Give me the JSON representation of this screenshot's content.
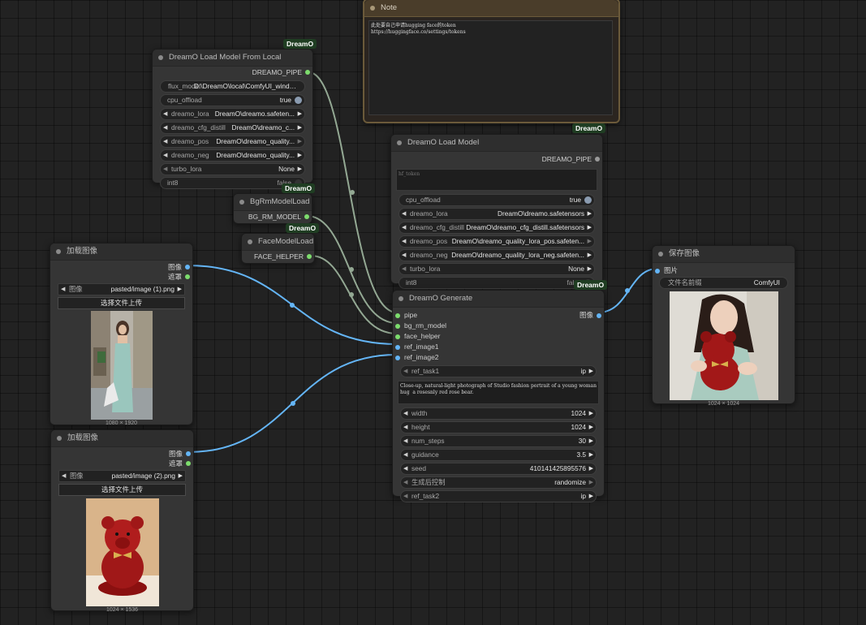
{
  "colors": {
    "canvas": "#222222",
    "node_bg": "#353535",
    "note_border": "#6b5a3a",
    "badge_bg": "#1f3d22",
    "image_wire": "#64b5f6",
    "model_wire": "#93a893",
    "socket_green": "#7ddc6d",
    "socket_blue": "#64b5f6"
  },
  "note": {
    "title": "Note",
    "text": "此处要自己申请hugging face的token\nhttps://huggingface.co/settings/tokens"
  },
  "badges": {
    "dreamo": "DreamO"
  },
  "local_model": {
    "title": "DreamO Load Model From Local",
    "output": "DREAMO_PIPE",
    "widgets": [
      {
        "label": "flux_model",
        "value": "D:\\DreamO\\local\\ComfyUI_windows"
      },
      {
        "label": "cpu_offload",
        "value": "true"
      },
      {
        "label": "dreamo_lora",
        "value": "DreamO\\dreamo.safeten..."
      },
      {
        "label": "dreamo_cfg_distill",
        "value": "DreamO\\dreamo_c..."
      },
      {
        "label": "dreamo_pos",
        "value": "DreamO\\dreamo_quality..."
      },
      {
        "label": "dreamo_neg",
        "value": "DreamO\\dreamo_quality..."
      },
      {
        "label": "turbo_lora",
        "value": "None"
      },
      {
        "label": "int8",
        "value": "false"
      }
    ]
  },
  "bgrm": {
    "title": "BgRmModelLoad",
    "output": "BG_RM_MODEL"
  },
  "face": {
    "title": "FaceModelLoad",
    "output": "FACE_HELPER"
  },
  "load_model": {
    "title": "DreamO Load Model",
    "output": "DREAMO_PIPE",
    "token_placeholder": "hf_token",
    "widgets": [
      {
        "label": "cpu_offload",
        "value": "true"
      },
      {
        "label": "dreamo_lora",
        "value": "DreamO\\dreamo.safetensors"
      },
      {
        "label": "dreamo_cfg_distill",
        "value": "DreamO\\dreamo_cfg_distill.safetensors"
      },
      {
        "label": "dreamo_pos",
        "value": "DreamO\\dreamo_quality_lora_pos.safeten..."
      },
      {
        "label": "dreamo_neg",
        "value": "DreamO\\dreamo_quality_lora_neg.safeten..."
      },
      {
        "label": "turbo_lora",
        "value": "None"
      },
      {
        "label": "int8",
        "value": "false"
      }
    ]
  },
  "load_image1": {
    "title": "加载图像",
    "out_image": "图像",
    "out_mask": "遮罩",
    "widget_label": "图像",
    "widget_value": "pasted/image (1).png",
    "upload": "选择文件上传",
    "dims": "1080 × 1920"
  },
  "load_image2": {
    "title": "加载图像",
    "out_image": "图像",
    "out_mask": "遮罩",
    "widget_label": "图像",
    "widget_value": "pasted/image (2).png",
    "upload": "选择文件上传",
    "dims": "1024 × 1536"
  },
  "generate": {
    "title": "DreamO Generate",
    "inputs": [
      "pipe",
      "bg_rm_model",
      "face_helper",
      "ref_image1",
      "ref_image2"
    ],
    "output": "图像",
    "ref_task1": {
      "label": "ref_task1",
      "value": "ip"
    },
    "prompt": "Close-up, natural-light photograph of Studio fashion portrait of a young woman hug  a rosesnly red rose bear.",
    "widgets": [
      {
        "label": "width",
        "value": "1024"
      },
      {
        "label": "height",
        "value": "1024"
      },
      {
        "label": "num_steps",
        "value": "30"
      },
      {
        "label": "guidance",
        "value": "3.5"
      },
      {
        "label": "seed",
        "value": "410141425895576"
      },
      {
        "label": "生成后控制",
        "value": "randomize"
      },
      {
        "label": "ref_task2",
        "value": "ip"
      }
    ]
  },
  "save_image": {
    "title": "保存图像",
    "input": "图片",
    "widget_label": "文件名前缀",
    "widget_value": "ComfyUI",
    "dims": "1024 × 1024"
  }
}
